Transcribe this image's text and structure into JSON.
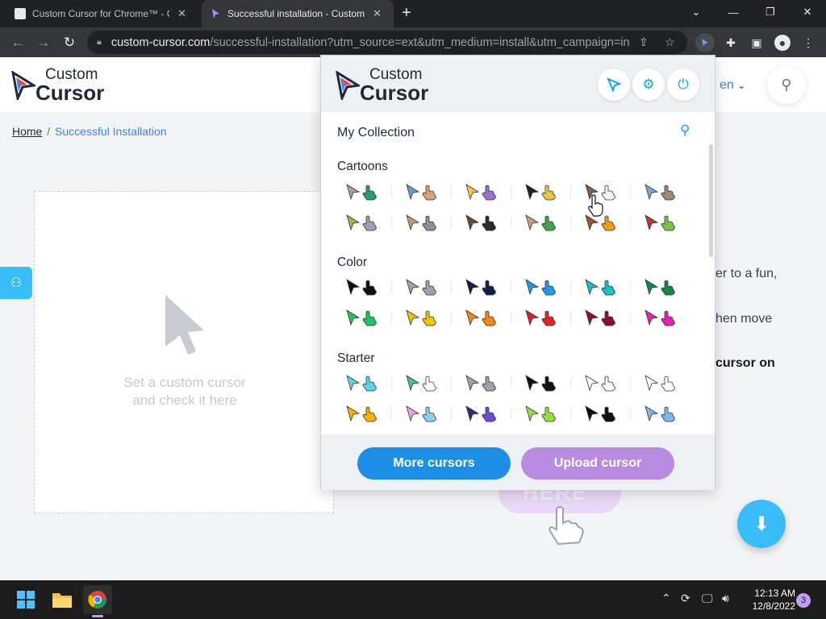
{
  "browser": {
    "tabs": [
      {
        "title": "Custom Cursor for Chrome™ - Ch",
        "active": false
      },
      {
        "title": "Successful installation - Custom C",
        "active": true
      }
    ],
    "new_tab": "+",
    "url_host": "custom-cursor.com",
    "url_path": "/successful-installation?utm_source=ext&utm_medium=install&utm_campaign=in..."
  },
  "site": {
    "logo_top": "Custom",
    "logo_bottom": "Cursor",
    "language": "en",
    "breadcrumb": {
      "home": "Home",
      "separator": "/",
      "current": "Successful Installation"
    },
    "preview_text_line1": "Set a custom cursor",
    "preview_text_line2": "and check it here",
    "side_text": [
      "er to a fun,",
      "hen move",
      "cursor on"
    ],
    "here_text": "HERE"
  },
  "popup": {
    "logo_top": "Custom",
    "logo_bottom": "Cursor",
    "collection_title": "My Collection",
    "sections": [
      {
        "title": "Cartoons"
      },
      {
        "title": "Color"
      },
      {
        "title": "Starter"
      }
    ],
    "more_button": "More cursors",
    "upload_button": "Upload cursor"
  },
  "taskbar": {
    "time": "12:13 AM",
    "date": "12/8/2022",
    "notification_count": "3"
  },
  "colors": {
    "accent_blue": "#1d8ee6",
    "accent_purple": "#b68be0",
    "sky": "#38bdf8"
  }
}
